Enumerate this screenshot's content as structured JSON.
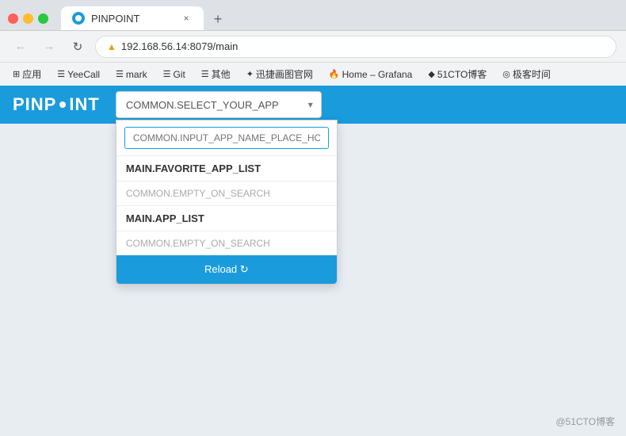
{
  "browser": {
    "tab_title": "PINPOINT",
    "tab_favicon_alt": "pinpoint-favicon",
    "close_label": "×",
    "new_tab_label": "+",
    "nav_back": "←",
    "nav_forward": "→",
    "nav_refresh": "↻",
    "address_security": "▲",
    "address_url": "192.168.56.14:8079/main",
    "bookmarks": [
      {
        "label": "应用",
        "icon": "⊞"
      },
      {
        "label": "YeeCall",
        "icon": "☰"
      },
      {
        "label": "mark",
        "icon": "☰"
      },
      {
        "label": "Git",
        "icon": "☰"
      },
      {
        "label": "其他",
        "icon": "☰"
      },
      {
        "label": "迅捷画图官网",
        "icon": "✦"
      },
      {
        "label": "Home – Grafana",
        "icon": "🔥"
      },
      {
        "label": "51CTO博客",
        "icon": "◆"
      },
      {
        "label": "极客时间",
        "icon": "◎"
      }
    ]
  },
  "app": {
    "logo_text": "PINP",
    "logo_dot": "•",
    "logo_suffix": "INT",
    "dropdown_placeholder": "COMMON.SELECT_YOUR_APP",
    "dropdown_arrow": "▾",
    "search_placeholder": "COMMON.INPUT_APP_NAME_PLACE_HOL",
    "favorite_header": "MAIN.FAVORITE_APP_LIST",
    "favorite_empty": "COMMON.EMPTY_ON_SEARCH",
    "app_list_header": "MAIN.APP_LIST",
    "app_list_empty": "COMMON.EMPTY_ON_SEARCH",
    "reload_label": "Reload ↻"
  },
  "watermark": "@51CTO博客"
}
